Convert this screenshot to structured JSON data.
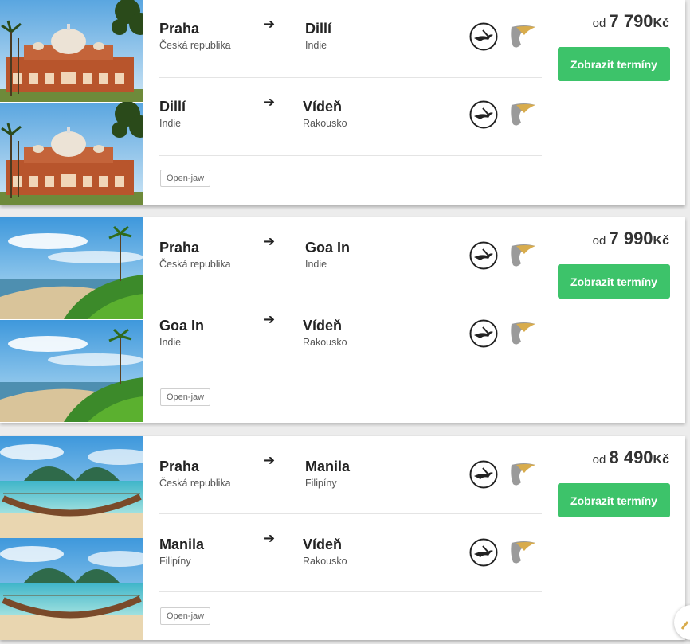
{
  "icons": {
    "arrow": "➔",
    "airline_1": "lufthansa-crane-icon",
    "airline_2": "airline-wing-icon",
    "scroll": "chevron-up-icon"
  },
  "colors": {
    "button": "#3dc36a",
    "accent": "#d8ac4d"
  },
  "offers": [
    {
      "price_prefix": "od",
      "price_amount": "7 790",
      "price_currency": "Kč",
      "button_label": "Zobrazit termíny",
      "tag": "Open-jaw",
      "legs": [
        {
          "from_city": "Praha",
          "from_country": "Česká republika",
          "to_city": "Dillí",
          "to_country": "Indie"
        },
        {
          "from_city": "Dillí",
          "from_country": "Indie",
          "to_city": "Vídeň",
          "to_country": "Rakousko"
        }
      ]
    },
    {
      "price_prefix": "od",
      "price_amount": "7 990",
      "price_currency": "Kč",
      "button_label": "Zobrazit termíny",
      "tag": "Open-jaw",
      "legs": [
        {
          "from_city": "Praha",
          "from_country": "Česká republika",
          "to_city": "Goa In",
          "to_country": "Indie"
        },
        {
          "from_city": "Goa In",
          "from_country": "Indie",
          "to_city": "Vídeň",
          "to_country": "Rakousko"
        }
      ]
    },
    {
      "price_prefix": "od",
      "price_amount": "8 490",
      "price_currency": "Kč",
      "button_label": "Zobrazit termíny",
      "tag": "Open-jaw",
      "legs": [
        {
          "from_city": "Praha",
          "from_country": "Česká republika",
          "to_city": "Manila",
          "to_country": "Filipíny"
        },
        {
          "from_city": "Manila",
          "from_country": "Filipíny",
          "to_city": "Vídeň",
          "to_country": "Rakousko"
        }
      ]
    }
  ]
}
